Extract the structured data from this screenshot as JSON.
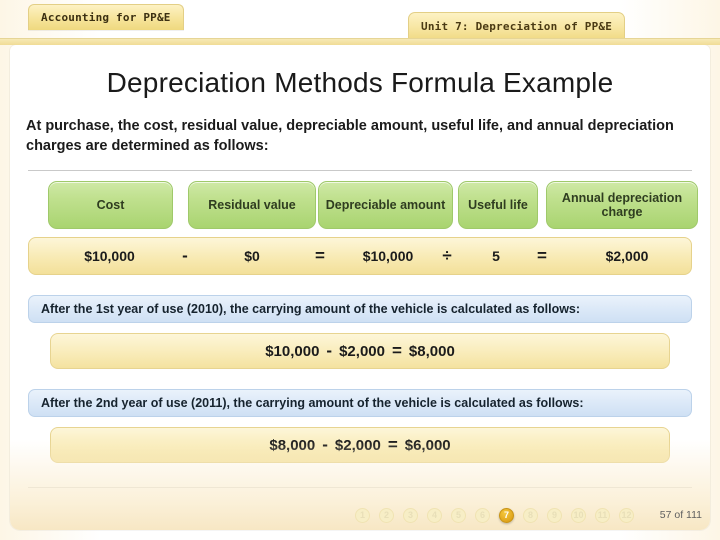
{
  "tabs": {
    "course": "Accounting for PP&E",
    "unit": "Unit 7: Depreciation of PP&E"
  },
  "title": "Depreciation Methods Formula Example",
  "intro": "At purchase, the cost, residual value, depreciable amount, useful life, and annual depreciation charges are determined as follows:",
  "formula": {
    "headers": [
      {
        "label": "Cost"
      },
      {
        "label": "Residual value"
      },
      {
        "label": "Depreciable amount"
      },
      {
        "label": "Useful life"
      },
      {
        "label": "Annual depreciation charge"
      }
    ],
    "values": {
      "cost": "$10,000",
      "op1": "-",
      "residual": "$0",
      "op2": "=",
      "depreciable": "$10,000",
      "op3": "÷",
      "useful_life": "5",
      "op4": "=",
      "annual_charge": "$2,000"
    }
  },
  "year1": {
    "statement": "After the 1st year of use (2010), the carrying amount of the vehicle is calculated as follows:",
    "calc": {
      "a": "$10,000",
      "op1": "-",
      "b": "$2,000",
      "op2": "=",
      "result": "$8,000"
    }
  },
  "year2": {
    "statement": "After the 2nd year of use (2011), the carrying amount of the vehicle is calculated as follows:",
    "calc": {
      "a": "$8,000",
      "op1": "-",
      "b": "$2,000",
      "op2": "=",
      "result": "$6,000"
    }
  },
  "footer": {
    "pages": [
      "1",
      "2",
      "3",
      "4",
      "5",
      "6",
      "7",
      "8",
      "9",
      "10",
      "11",
      "12"
    ],
    "active_page": "7",
    "page_count": "57 of 111"
  },
  "colors": {
    "header_green": "#bfe08d",
    "value_yellow": "#f8eab3",
    "statement_blue": "#d9e7f7",
    "active_page": "#e0a51c",
    "tab_yellow": "#f6e49a"
  }
}
